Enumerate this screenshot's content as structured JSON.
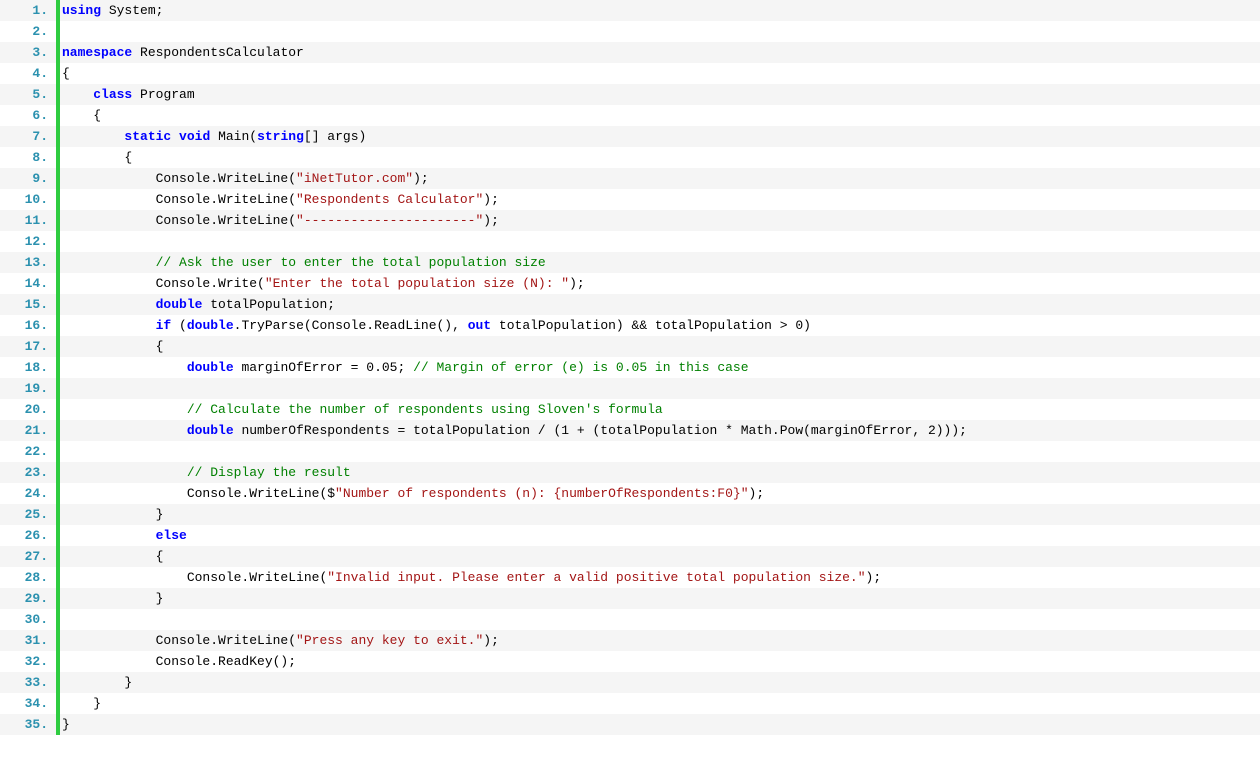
{
  "lines": [
    {
      "n": "1.",
      "tokens": [
        {
          "t": "using",
          "c": "kw"
        },
        {
          "t": " System;",
          "c": "id"
        }
      ]
    },
    {
      "n": "2.",
      "tokens": []
    },
    {
      "n": "3.",
      "tokens": [
        {
          "t": "namespace",
          "c": "kw"
        },
        {
          "t": " RespondentsCalculator",
          "c": "id"
        }
      ]
    },
    {
      "n": "4.",
      "tokens": [
        {
          "t": "{",
          "c": "id"
        }
      ]
    },
    {
      "n": "5.",
      "tokens": [
        {
          "t": "    ",
          "c": "id"
        },
        {
          "t": "class",
          "c": "kw"
        },
        {
          "t": " Program",
          "c": "id"
        }
      ]
    },
    {
      "n": "6.",
      "tokens": [
        {
          "t": "    {",
          "c": "id"
        }
      ]
    },
    {
      "n": "7.",
      "tokens": [
        {
          "t": "        ",
          "c": "id"
        },
        {
          "t": "static",
          "c": "kw"
        },
        {
          "t": " ",
          "c": "id"
        },
        {
          "t": "void",
          "c": "kw"
        },
        {
          "t": " Main(",
          "c": "id"
        },
        {
          "t": "string",
          "c": "kw"
        },
        {
          "t": "[] args)",
          "c": "id"
        }
      ]
    },
    {
      "n": "8.",
      "tokens": [
        {
          "t": "        {",
          "c": "id"
        }
      ]
    },
    {
      "n": "9.",
      "tokens": [
        {
          "t": "            Console.WriteLine(",
          "c": "id"
        },
        {
          "t": "\"iNetTutor.com\"",
          "c": "str"
        },
        {
          "t": ");",
          "c": "id"
        }
      ]
    },
    {
      "n": "10.",
      "tokens": [
        {
          "t": "            Console.WriteLine(",
          "c": "id"
        },
        {
          "t": "\"Respondents Calculator\"",
          "c": "str"
        },
        {
          "t": ");",
          "c": "id"
        }
      ]
    },
    {
      "n": "11.",
      "tokens": [
        {
          "t": "            Console.WriteLine(",
          "c": "id"
        },
        {
          "t": "\"----------------------\"",
          "c": "str"
        },
        {
          "t": ");",
          "c": "id"
        }
      ]
    },
    {
      "n": "12.",
      "tokens": []
    },
    {
      "n": "13.",
      "tokens": [
        {
          "t": "            ",
          "c": "id"
        },
        {
          "t": "// Ask the user to enter the total population size",
          "c": "cm"
        }
      ]
    },
    {
      "n": "14.",
      "tokens": [
        {
          "t": "            Console.Write(",
          "c": "id"
        },
        {
          "t": "\"Enter the total population size (N): \"",
          "c": "str"
        },
        {
          "t": ");",
          "c": "id"
        }
      ]
    },
    {
      "n": "15.",
      "tokens": [
        {
          "t": "            ",
          "c": "id"
        },
        {
          "t": "double",
          "c": "kw"
        },
        {
          "t": " totalPopulation;",
          "c": "id"
        }
      ]
    },
    {
      "n": "16.",
      "tokens": [
        {
          "t": "            ",
          "c": "id"
        },
        {
          "t": "if",
          "c": "kw"
        },
        {
          "t": " (",
          "c": "id"
        },
        {
          "t": "double",
          "c": "kw"
        },
        {
          "t": ".TryParse(Console.ReadLine(), ",
          "c": "id"
        },
        {
          "t": "out",
          "c": "kw"
        },
        {
          "t": " totalPopulation) && totalPopulation > 0)",
          "c": "id"
        }
      ]
    },
    {
      "n": "17.",
      "tokens": [
        {
          "t": "            {",
          "c": "id"
        }
      ]
    },
    {
      "n": "18.",
      "tokens": [
        {
          "t": "                ",
          "c": "id"
        },
        {
          "t": "double",
          "c": "kw"
        },
        {
          "t": " marginOfError = 0.05; ",
          "c": "id"
        },
        {
          "t": "// Margin of error (e) is 0.05 in this case",
          "c": "cm"
        }
      ]
    },
    {
      "n": "19.",
      "tokens": []
    },
    {
      "n": "20.",
      "tokens": [
        {
          "t": "                ",
          "c": "id"
        },
        {
          "t": "// Calculate the number of respondents using Sloven's formula",
          "c": "cm"
        }
      ]
    },
    {
      "n": "21.",
      "tokens": [
        {
          "t": "                ",
          "c": "id"
        },
        {
          "t": "double",
          "c": "kw"
        },
        {
          "t": " numberOfRespondents = totalPopulation / (1 + (totalPopulation * Math.Pow(marginOfError, 2)));",
          "c": "id"
        }
      ]
    },
    {
      "n": "22.",
      "tokens": []
    },
    {
      "n": "23.",
      "tokens": [
        {
          "t": "                ",
          "c": "id"
        },
        {
          "t": "// Display the result",
          "c": "cm"
        }
      ]
    },
    {
      "n": "24.",
      "tokens": [
        {
          "t": "                Console.WriteLine($",
          "c": "id"
        },
        {
          "t": "\"Number of respondents (n): {numberOfRespondents:F0}\"",
          "c": "str"
        },
        {
          "t": ");",
          "c": "id"
        }
      ]
    },
    {
      "n": "25.",
      "tokens": [
        {
          "t": "            }",
          "c": "id"
        }
      ]
    },
    {
      "n": "26.",
      "tokens": [
        {
          "t": "            ",
          "c": "id"
        },
        {
          "t": "else",
          "c": "kw"
        }
      ]
    },
    {
      "n": "27.",
      "tokens": [
        {
          "t": "            {",
          "c": "id"
        }
      ]
    },
    {
      "n": "28.",
      "tokens": [
        {
          "t": "                Console.WriteLine(",
          "c": "id"
        },
        {
          "t": "\"Invalid input. Please enter a valid positive total population size.\"",
          "c": "str"
        },
        {
          "t": ");",
          "c": "id"
        }
      ]
    },
    {
      "n": "29.",
      "tokens": [
        {
          "t": "            }",
          "c": "id"
        }
      ]
    },
    {
      "n": "30.",
      "tokens": []
    },
    {
      "n": "31.",
      "tokens": [
        {
          "t": "            Console.WriteLine(",
          "c": "id"
        },
        {
          "t": "\"Press any key to exit.\"",
          "c": "str"
        },
        {
          "t": ");",
          "c": "id"
        }
      ]
    },
    {
      "n": "32.",
      "tokens": [
        {
          "t": "            Console.ReadKey();",
          "c": "id"
        }
      ]
    },
    {
      "n": "33.",
      "tokens": [
        {
          "t": "        }",
          "c": "id"
        }
      ]
    },
    {
      "n": "34.",
      "tokens": [
        {
          "t": "    }",
          "c": "id"
        }
      ]
    },
    {
      "n": "35.",
      "tokens": [
        {
          "t": "}",
          "c": "id"
        }
      ]
    }
  ]
}
